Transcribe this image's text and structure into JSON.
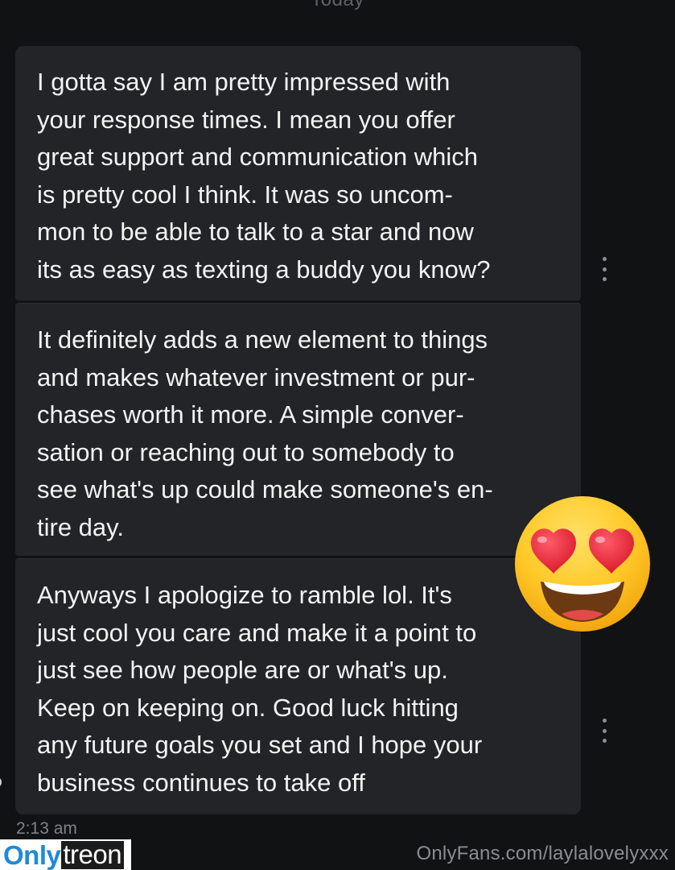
{
  "header": {
    "day_label": "Today"
  },
  "messages": [
    {
      "text": "I gotta say I am pretty impressed with\nyour response times. I mean you offer\ngreat support and communication which\nis pretty cool I think. It was so uncom-\nmon to be able to talk to a star and now\nits as easy as texting a buddy you know?",
      "more_icon": "more-vertical-icon"
    },
    {
      "text": "It definitely adds a new element to things\nand makes whatever investment or pur-\nchases worth it more. A simple conver-\nsation or reaching out to somebody to\nsee what's up could make someone's en-\ntire day."
    },
    {
      "text": "Anyways I apologize to ramble lol. It's\njust cool you care and make it a point to\njust see how people are or what's up.\nKeep on keeping on. Good luck hitting\nany future goals you set and I hope your\nbusiness continues to take off",
      "more_icon": "more-vertical-icon"
    }
  ],
  "timestamp": "2:13 am",
  "overlay": {
    "emoji": "heart-eyes-emoji",
    "logo_part_a": "Only",
    "logo_part_b": "treon",
    "watermark": "OnlyFans.com/laylalovelyxxx"
  },
  "colors": {
    "background": "#111214",
    "bubble": "#232427",
    "text": "#f3f3f3",
    "muted": "#7f8287",
    "logo_blue": "#1e8ad7"
  }
}
